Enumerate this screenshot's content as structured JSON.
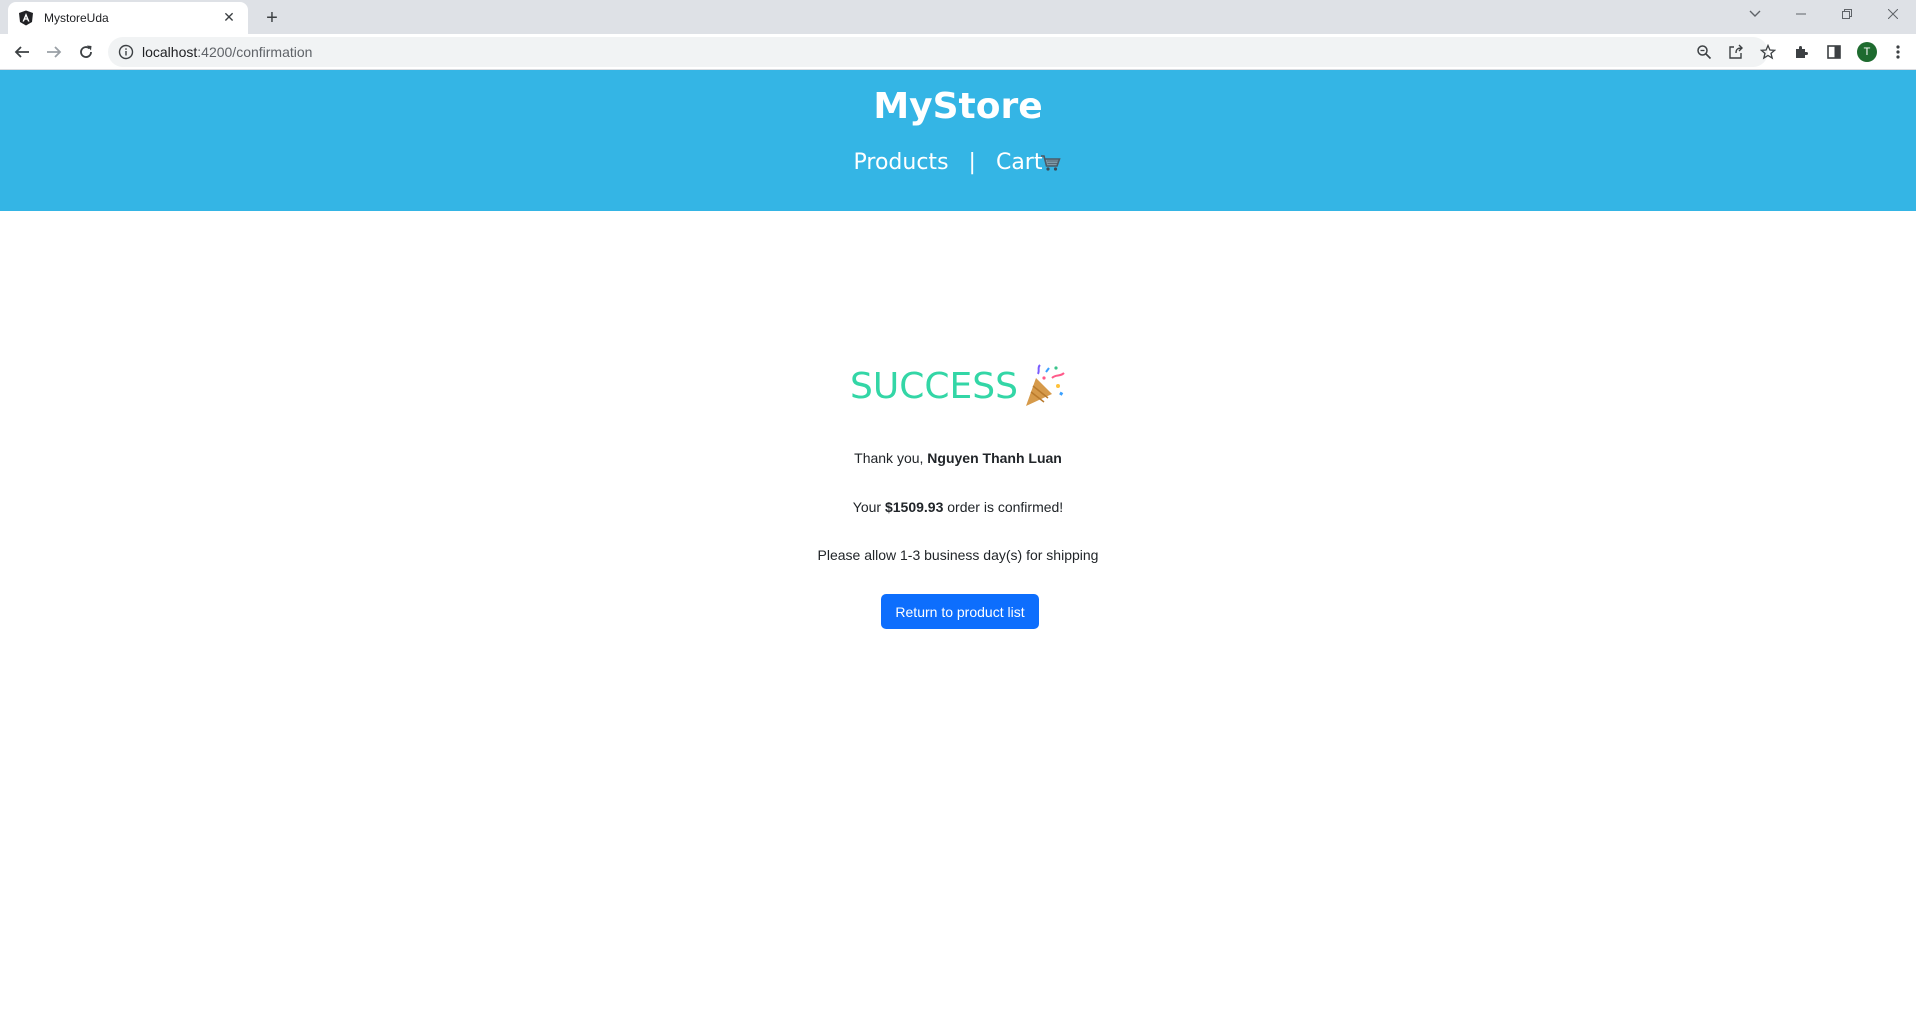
{
  "browser": {
    "tab_title": "MystoreUda",
    "tab_close": "✕",
    "new_tab": "+",
    "url_host": "localhost",
    "url_path": ":4200/confirmation",
    "avatar_letter": "T"
  },
  "header": {
    "title": "MyStore",
    "nav": {
      "products": "Products",
      "separator": "|",
      "cart": "Cart"
    }
  },
  "confirmation": {
    "heading": "SUCCESS",
    "thank_you_prefix": "Thank you, ",
    "customer_name": "Nguyen Thanh Luan",
    "order_prefix": "Your ",
    "order_total": "$1509.93",
    "order_suffix": " order is confirmed!",
    "shipping_note": "Please allow 1-3 business day(s) for shipping",
    "return_button": "Return to product list"
  },
  "colors": {
    "header_bg": "#34b5e5",
    "success_text": "#33d6a6",
    "primary_button": "#0d6efd"
  },
  "icons": [
    "angular-favicon-icon",
    "close-icon",
    "plus-icon",
    "chevron-down-icon",
    "minimize-icon",
    "restore-icon",
    "window-close-icon",
    "back-arrow-icon",
    "forward-arrow-icon",
    "reload-icon",
    "info-icon",
    "zoom-icon",
    "share-icon",
    "star-icon",
    "extensions-icon",
    "side-panel-icon",
    "menu-kebab-icon",
    "cart-icon",
    "party-popper-icon"
  ]
}
